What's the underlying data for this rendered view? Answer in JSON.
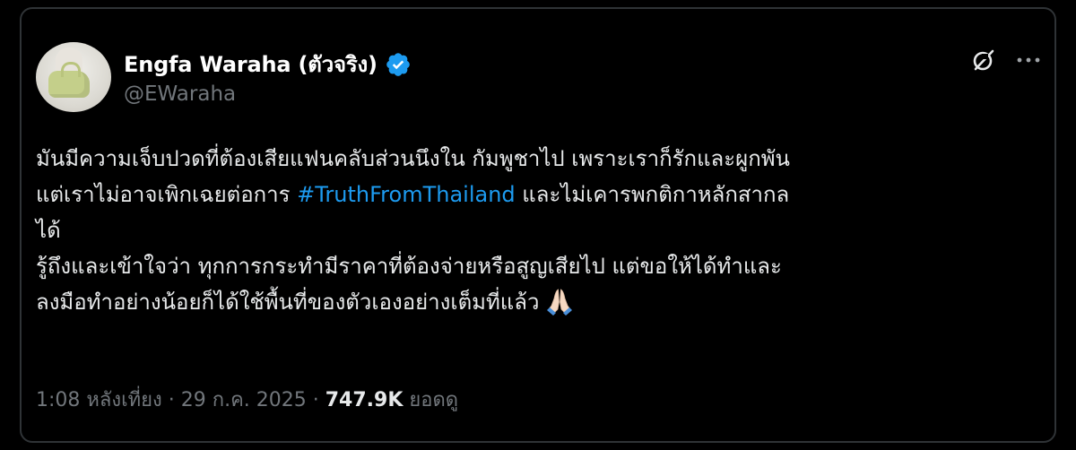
{
  "tweet": {
    "author": {
      "display_name": "Engfa Waraha (ตัวจริง)",
      "handle": "@EWaraha",
      "verified": true,
      "verified_icon": "verified-badge-icon",
      "avatar_icon": "avatar"
    },
    "actions": {
      "grok_icon": "grok-icon",
      "more_icon": "more-options-icon"
    },
    "text": {
      "line1": "มันมีความเจ็บปวดที่ต้องเสียแฟนคลับส่วนนึงใน กัมพูชาไป เพราะเราก็รักและผูกพัน",
      "line2_before": "แต่เราไม่อาจเพิกเฉยต่อการ ",
      "hashtag": "#TruthFromThailand",
      "line2_after": " และไม่เคารพกติกาหลักสากล",
      "line3": "ได้",
      "line4": "รู้ถึงและเข้าใจว่า ทุกการกระทำมีราคาที่ต้องจ่ายหรือสูญเสียไป  แต่ขอให้ได้ทำและ",
      "line5": "ลงมือทำอย่างน้อยก็ได้ใช้พื้นที่ของตัวเองอย่างเต็มที่แล้ว",
      "emoji": "folded-hands-icon"
    },
    "meta": {
      "time": "1:08 หลังเที่ยง",
      "separator": " · ",
      "date": "29 ก.ค. 2025",
      "views_count": "747.9K",
      "views_label": "ยอดดู"
    }
  },
  "colors": {
    "background": "#000000",
    "text_primary": "#e7e9ea",
    "text_secondary": "#71767b",
    "link": "#1d9bf0",
    "verified": "#1d9bf0",
    "border": "#2f3336"
  }
}
